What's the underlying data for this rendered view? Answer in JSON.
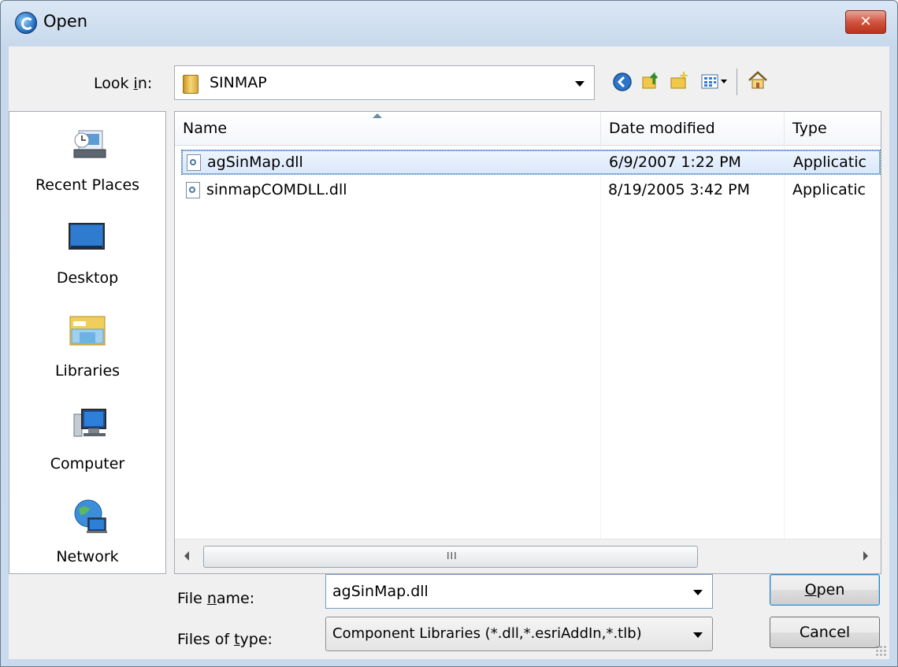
{
  "window": {
    "title": "Open",
    "close_glyph": "✕"
  },
  "toolbar": {
    "look_in_label_pre": "Look ",
    "look_in_label_key": "i",
    "look_in_label_post": "n:",
    "look_in_value": "SINMAP",
    "icons": [
      "back-icon",
      "up-folder-icon",
      "new-folder-icon",
      "view-menu-icon",
      "home-icon"
    ]
  },
  "places": [
    {
      "label": "Recent Places",
      "icon": "recent-places-icon"
    },
    {
      "label": "Desktop",
      "icon": "desktop-icon"
    },
    {
      "label": "Libraries",
      "icon": "libraries-icon"
    },
    {
      "label": "Computer",
      "icon": "computer-icon"
    },
    {
      "label": "Network",
      "icon": "network-icon"
    }
  ],
  "file_list": {
    "columns": [
      "Name",
      "Date modified",
      "Type"
    ],
    "rows": [
      {
        "name": "agSinMap.dll",
        "date": "6/9/2007 1:22 PM",
        "type": "Applicatic",
        "selected": true
      },
      {
        "name": "sinmapCOMDLL.dll",
        "date": "8/19/2005 3:42 PM",
        "type": "Applicatic",
        "selected": false
      }
    ],
    "scroll_grip": "III"
  },
  "form": {
    "file_name_label_pre": "File ",
    "file_name_label_key": "n",
    "file_name_label_post": "ame:",
    "file_name_value": "agSinMap.dll",
    "file_type_label_pre": "Files of ",
    "file_type_label_key": "t",
    "file_type_label_post": "ype:",
    "file_type_value": "Component Libraries (*.dll,*.esriAddIn,*.tlb)"
  },
  "buttons": {
    "open_key": "O",
    "open_rest": "pen",
    "cancel": "Cancel"
  },
  "colors": {
    "selection": "#d8e8fb",
    "accent": "#3c7fb1"
  }
}
